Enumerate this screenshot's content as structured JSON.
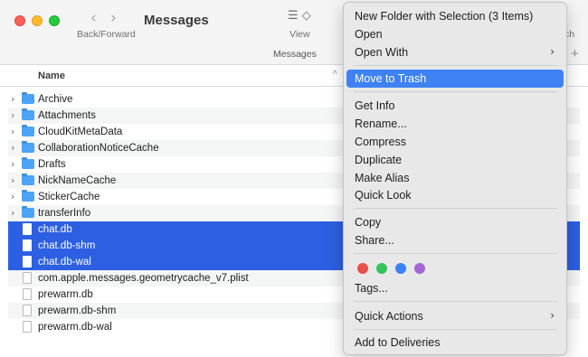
{
  "window": {
    "title": "Messages",
    "nav_label": "Back/Forward",
    "view_label": "View",
    "search_label_visible": "ch",
    "path_tab": "Messages"
  },
  "icons": {
    "back": "‹",
    "forward": "›",
    "view": "☰ ◇",
    "disclosure": "›",
    "plus": "+",
    "sort": "^",
    "submenu": "›"
  },
  "columns": {
    "name": "Name"
  },
  "files": [
    {
      "name": "Archive",
      "kind": "folder",
      "selected": false
    },
    {
      "name": "Attachments",
      "kind": "folder",
      "selected": false
    },
    {
      "name": "CloudKitMetaData",
      "kind": "folder",
      "selected": false
    },
    {
      "name": "CollaborationNoticeCache",
      "kind": "folder",
      "selected": false
    },
    {
      "name": "Drafts",
      "kind": "folder",
      "selected": false
    },
    {
      "name": "NickNameCache",
      "kind": "folder",
      "selected": false
    },
    {
      "name": "StickerCache",
      "kind": "folder",
      "selected": false
    },
    {
      "name": "transferInfo",
      "kind": "folder",
      "selected": false
    },
    {
      "name": "chat.db",
      "kind": "file",
      "selected": true
    },
    {
      "name": "chat.db-shm",
      "kind": "file",
      "selected": true
    },
    {
      "name": "chat.db-wal",
      "kind": "file",
      "selected": true
    },
    {
      "name": "com.apple.messages.geometrycache_v7.plist",
      "kind": "file",
      "selected": false
    },
    {
      "name": "prewarm.db",
      "kind": "file",
      "selected": false
    },
    {
      "name": "prewarm.db-shm",
      "kind": "file",
      "selected": false
    },
    {
      "name": "prewarm.db-wal",
      "kind": "file",
      "selected": false
    }
  ],
  "menu": {
    "new_folder": "New Folder with Selection (3 Items)",
    "open": "Open",
    "open_with": "Open With",
    "move_to_trash": "Move to Trash",
    "get_info": "Get Info",
    "rename": "Rename...",
    "compress": "Compress",
    "duplicate": "Duplicate",
    "make_alias": "Make Alias",
    "quick_look": "Quick Look",
    "copy": "Copy",
    "share": "Share...",
    "tags": "Tags...",
    "quick_actions": "Quick Actions",
    "add_to_deliveries": "Add to Deliveries",
    "tag_colors": [
      "#ec4d4d",
      "#33c25b",
      "#3a82f7",
      "#a665d6"
    ]
  }
}
